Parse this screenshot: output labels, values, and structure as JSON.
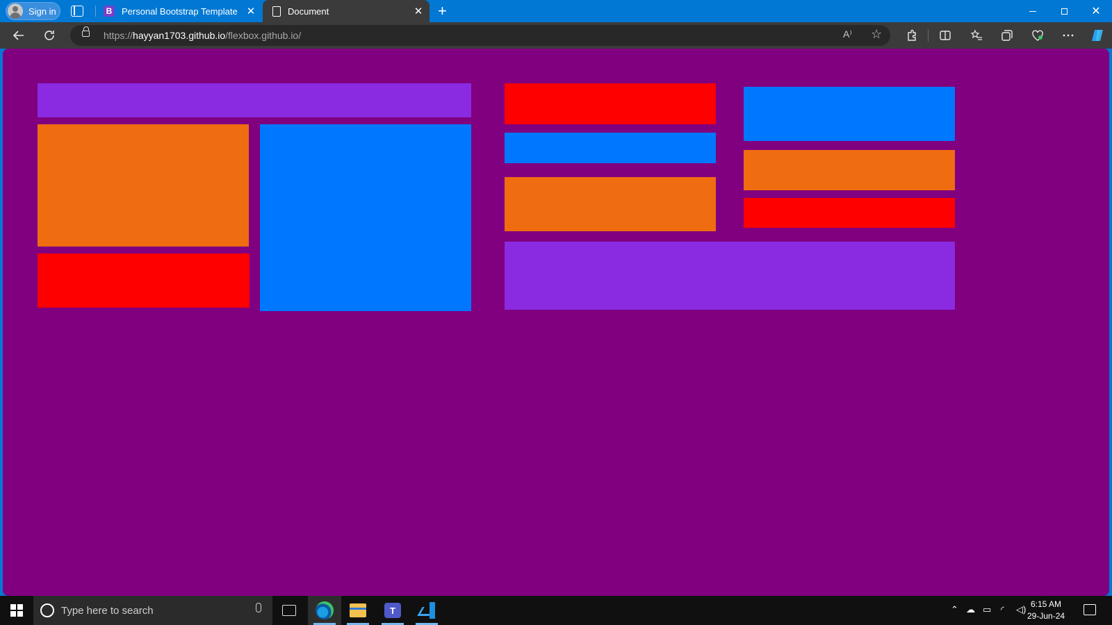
{
  "browser": {
    "profile_label": "Sign in",
    "tabs": [
      {
        "favicon": "B",
        "title": "Personal Bootstrap Template",
        "close": "✕"
      },
      {
        "title": "Document",
        "close": "✕"
      }
    ],
    "new_tab": "+",
    "window_controls": {
      "minimize": "",
      "maximize": "",
      "close": "✕"
    },
    "url_scheme": "https://",
    "url_host": "hayyan1703.github.io",
    "url_path": "/flexbox.github.io/",
    "read_aloud": "A⁾",
    "favorite_star": "☆",
    "toolbar_icons": [
      "extensions-icon",
      "split-screen-icon",
      "favorites-icon",
      "collections-icon",
      "browser-essentials-icon",
      "more-icon",
      "copilot-icon"
    ]
  },
  "page": {
    "background": "#800080",
    "colors": {
      "purple": "#8a2be2",
      "orange": "#f06c10",
      "red": "#ff0000",
      "blue": "#0077ff"
    }
  },
  "taskbar": {
    "search_placeholder": "Type here to search",
    "apps": [
      "edge-icon",
      "file-explorer-icon",
      "teams-icon",
      "vscode-icon"
    ],
    "time": "6:15 AM",
    "date": "29-Jun-24",
    "teams_badge": "T"
  }
}
